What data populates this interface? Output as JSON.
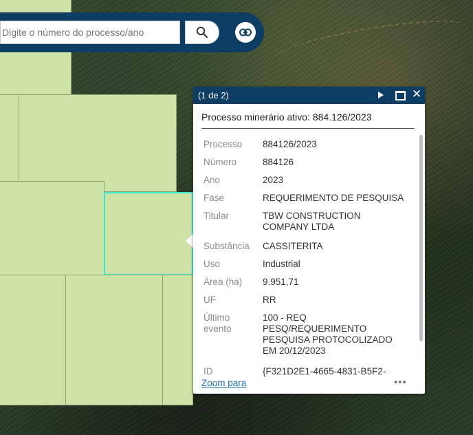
{
  "search": {
    "placeholder": "Digite o número do processo/ano",
    "search_icon": "search-icon",
    "link_icon": "link-icon"
  },
  "colors": {
    "header_bg": "#0e3d63",
    "parcel_fill": "#cfe3a8",
    "selected_outline": "#3ee6d4",
    "link": "#1f6fa8"
  },
  "popup": {
    "count": "(1 de 2)",
    "title": "Processo minerário ativo: 884.126/2023",
    "fields": [
      {
        "label": "Processo",
        "value": "884126/2023"
      },
      {
        "label": "Número",
        "value": "884126"
      },
      {
        "label": "Ano",
        "value": "2023"
      },
      {
        "label": "Fase",
        "value": "REQUERIMENTO DE PESQUISA"
      },
      {
        "label": "Titular",
        "value": "TBW CONSTRUCTION COMPANY LTDA"
      },
      {
        "label": "Substância",
        "value": "CASSITERITA"
      },
      {
        "label": "Uso",
        "value": "Industrial"
      },
      {
        "label": "Área (ha)",
        "value": "9.951,71"
      },
      {
        "label": "UF",
        "value": "RR"
      },
      {
        "label": "Último evento",
        "value": "100 - REQ PESQ/REQUERIMENTO PESQUISA PROTOCOLIZADO EM 20/12/2023"
      },
      {
        "label": "ID",
        "value": "{F321D2E1-4665-4831-B5F2-"
      }
    ],
    "zoom_label": "Zoom para",
    "more_label": "•••",
    "close_label": "✕",
    "next_icon": "play-icon",
    "dock_icon": "dock-icon"
  }
}
